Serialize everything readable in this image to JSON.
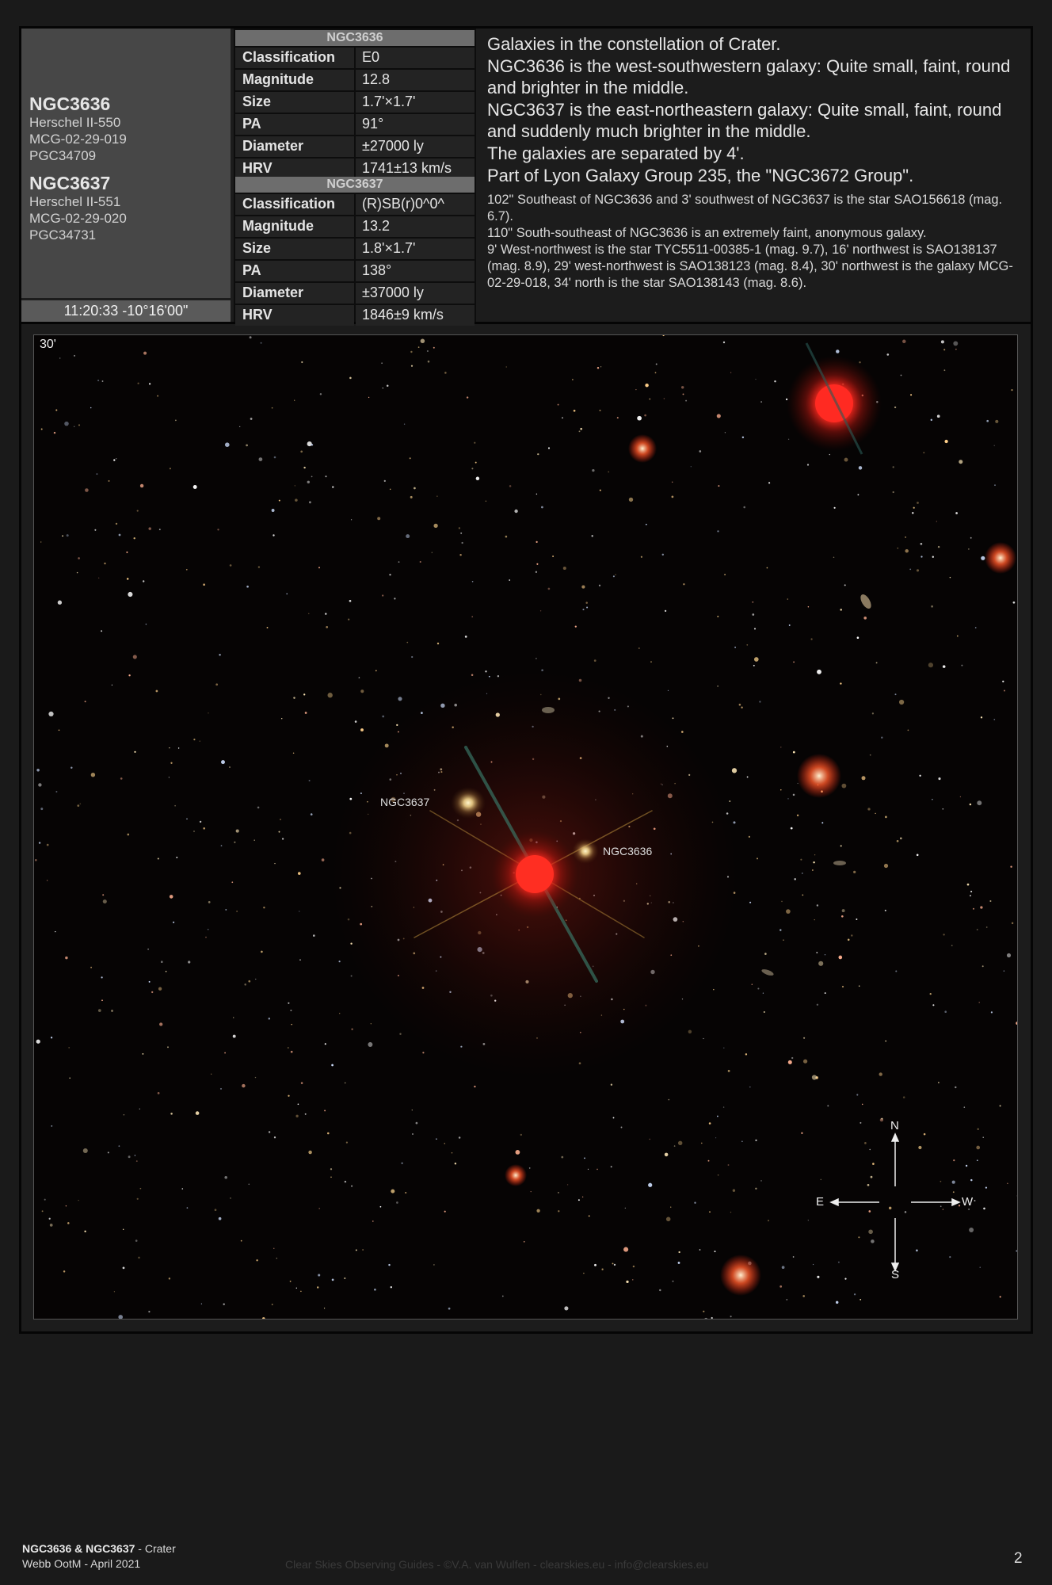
{
  "galaxy1": {
    "name": "NGC3636",
    "aliases": [
      "Herschel II-550",
      "MCG-02-29-019",
      "PGC34709"
    ]
  },
  "galaxy2": {
    "name": "NGC3637",
    "aliases": [
      "Herschel II-551",
      "MCG-02-29-020",
      "PGC34731"
    ]
  },
  "coordinates": "11:20:33 -10°16'00\"",
  "table1": {
    "title": "NGC3636",
    "rows": [
      {
        "label": "Classification",
        "value": "E0"
      },
      {
        "label": "Magnitude",
        "value": "12.8"
      },
      {
        "label": "Size",
        "value": "1.7'×1.7'"
      },
      {
        "label": "PA",
        "value": "91°"
      },
      {
        "label": "Diameter",
        "value": "±27000 ly"
      },
      {
        "label": "HRV",
        "value": "1741±13 km/s"
      }
    ]
  },
  "table2": {
    "title": "NGC3637",
    "rows": [
      {
        "label": "Classification",
        "value": "(R)SB(r)0^0^"
      },
      {
        "label": "Magnitude",
        "value": "13.2"
      },
      {
        "label": "Size",
        "value": "1.8'×1.7'"
      },
      {
        "label": "PA",
        "value": "138°"
      },
      {
        "label": "Diameter",
        "value": "±37000 ly"
      },
      {
        "label": "HRV",
        "value": "1846±9 km/s"
      }
    ]
  },
  "description": {
    "main": [
      "Galaxies in the constellation of Crater.",
      "NGC3636 is the west-southwestern galaxy: Quite small, faint, round and brighter in the middle.",
      "NGC3637 is the east-northeastern galaxy: Quite small, faint, round and suddenly much brighter in the middle.",
      "The galaxies are separated by 4'.",
      "Part of Lyon Galaxy Group 235, the \"NGC3672 Group\"."
    ],
    "notes": [
      "102\" Southeast of NGC3636 and 3' southwest of NGC3637 is the star SAO156618 (mag. 6.7).",
      "110\" South-southeast of NGC3636 is an extremely faint, anonymous galaxy.",
      "9' West-northwest is the star TYC5511-00385-1 (mag. 9.7), 16' northwest is SAO138137 (mag. 8.9), 29' west-northwest is SAO138123 (mag. 8.4), 30' northwest is the galaxy MCG-02-29-018, 34' north is the star SAO138143 (mag. 8.6)."
    ]
  },
  "image": {
    "scale_label": "30'",
    "label_ngc3637": "NGC3637",
    "label_ngc3636": "NGC3636",
    "compass": {
      "n": "N",
      "s": "S",
      "e": "E",
      "w": "W"
    }
  },
  "footer": {
    "title_bold": "NGC3636 & NGC3637",
    "title_rest": " - Crater",
    "subtitle": "Webb OotM - April 2021",
    "credits": "Clear Skies Observing Guides - ©V.A. van Wulfen - clearskies.eu - info@clearskies.eu",
    "page_number": "2"
  }
}
